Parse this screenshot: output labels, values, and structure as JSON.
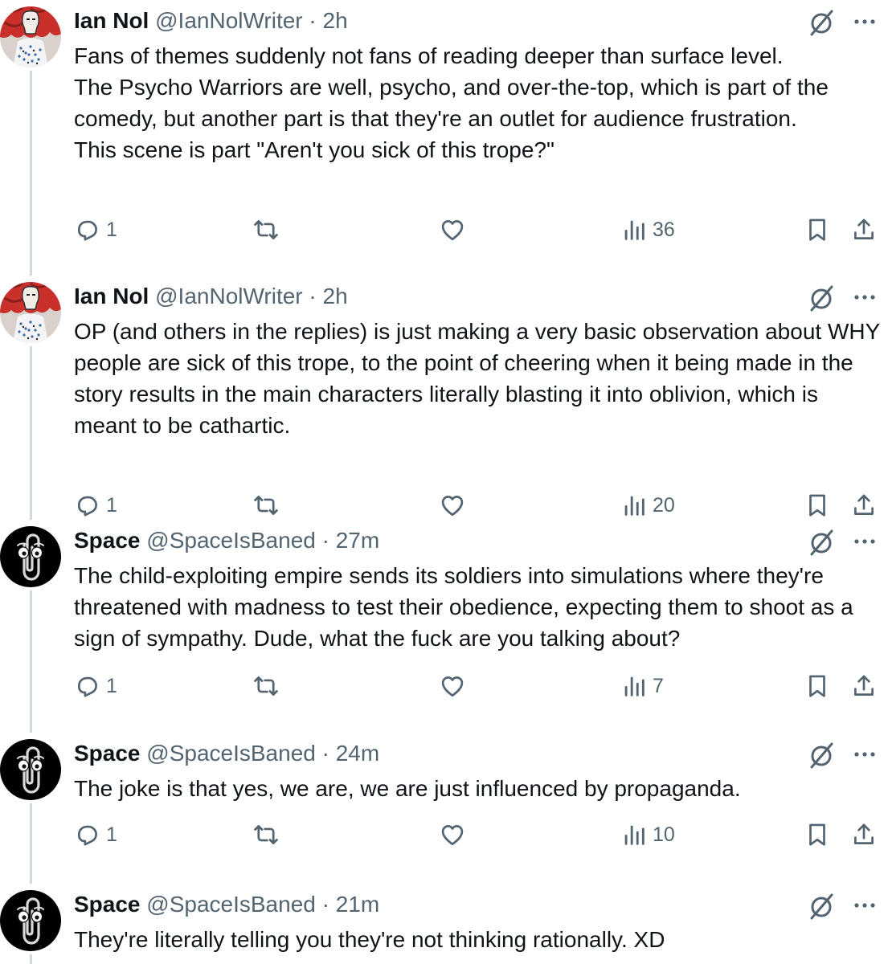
{
  "tweets": [
    {
      "avatar": "red-art-avatar",
      "name": "Ian Nol",
      "handle": "@IanNolWriter",
      "separator": "·",
      "time": "2h",
      "text": "Fans of themes suddenly not fans of reading deeper than surface level.\nThe Psycho Warriors are well, psycho, and over-the-top, which is part of the comedy, but another part is that they're an outlet for audience frustration.\nThis scene is part \"Aren't you sick of this trope?\"",
      "replies": "1",
      "views": "36"
    },
    {
      "avatar": "red-art-avatar",
      "name": "Ian Nol",
      "handle": "@IanNolWriter",
      "separator": "·",
      "time": "2h",
      "text": "OP (and others in the replies) is just making a very basic observation about WHY people are sick of this trope, to the point of cheering when it being made in the story results in the main characters literally blasting it into oblivion, which is meant to be cathartic.",
      "replies": "1",
      "views": "20"
    },
    {
      "avatar": "paperclip-avatar",
      "name": "Space",
      "handle": "@SpaceIsBaned",
      "separator": "·",
      "time": "27m",
      "text": "The child-exploiting empire sends its soldiers into simulations where they're threatened with madness to test their obedience, expecting them to shoot as a sign of sympathy. Dude, what the fuck are you talking about?",
      "replies": "1",
      "views": "7"
    },
    {
      "avatar": "paperclip-avatar",
      "name": "Space",
      "handle": "@SpaceIsBaned",
      "separator": "·",
      "time": "24m",
      "text": "The joke is that yes, we are, we are just influenced by propaganda.",
      "replies": "1",
      "views": "10"
    },
    {
      "avatar": "paperclip-avatar",
      "name": "Space",
      "handle": "@SpaceIsBaned",
      "separator": "·",
      "time": "21m",
      "text": "They're literally telling you they're not thinking rationally. XD"
    }
  ],
  "icons": {
    "grok": "grok-icon",
    "more": "more-icon",
    "reply": "reply-icon",
    "retweet": "retweet-icon",
    "like": "like-icon",
    "views": "views-icon",
    "bookmark": "bookmark-icon",
    "share": "share-icon"
  },
  "colors": {
    "text": "#0f1419",
    "secondary": "#536471",
    "thread_line": "#cfd9de",
    "avatar_red": "#c9302c",
    "avatar_dark": "#000000"
  }
}
